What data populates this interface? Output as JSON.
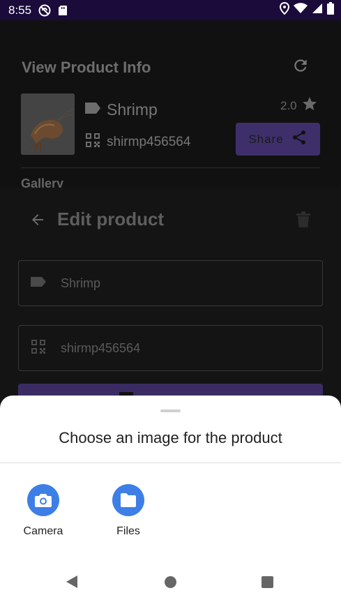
{
  "status_bar": {
    "time": "8:55",
    "icons_left": [
      "do-not-disturb-icon",
      "sd-card-icon"
    ],
    "icons_right": [
      "location-icon",
      "wifi-icon",
      "signal-icon",
      "battery-icon"
    ]
  },
  "view_product": {
    "title": "View Product Info",
    "product_name": "Shrimp",
    "product_code": "shirmp456564",
    "rating": "2.0",
    "share_label": "Share",
    "gallery_label": "Gallery"
  },
  "edit_product": {
    "title": "Edit product",
    "name_field_value": "Shrimp",
    "code_field_value": "shirmp456564"
  },
  "bottom_sheet": {
    "title": "Choose an image for the product",
    "options": [
      {
        "label": "Camera",
        "icon": "camera-icon"
      },
      {
        "label": "Files",
        "icon": "folder-icon"
      }
    ]
  },
  "colors": {
    "status_bar_bg": "#1a0b3a",
    "accent_purple": "#3e2f6b",
    "option_blue": "#3d7fe6",
    "sheet_bg": "#ffffff"
  }
}
